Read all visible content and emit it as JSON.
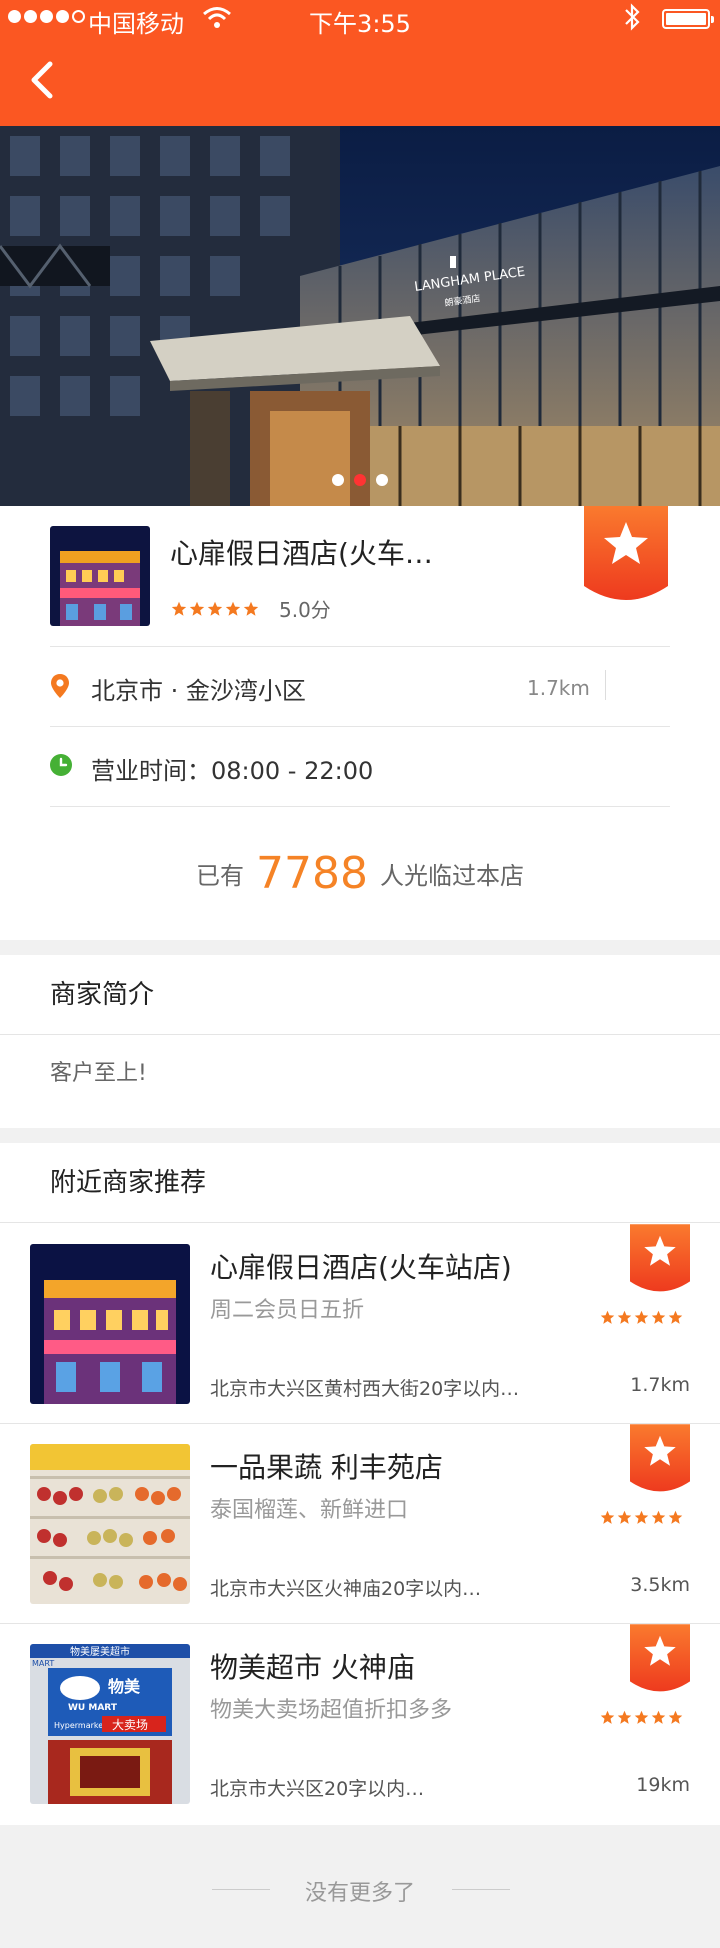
{
  "status_bar": {
    "carrier": "中国移动",
    "time": "下午3:55"
  },
  "colors": {
    "brand": "#fb5722",
    "accent_number": "#f58326",
    "star": "#f47920",
    "hours_icon": "#45b035"
  },
  "shop": {
    "name": "心扉假日酒店(火车…",
    "rating_stars": 5,
    "score": "5.0分",
    "address": "北京市 · 金沙湾小区",
    "distance": "1.7km",
    "hours": "营业时间：08:00 - 22:00",
    "visit_prefix": "已有",
    "visit_count": "7788",
    "visit_suffix": "人光临过本店"
  },
  "hero": {
    "building_sign_1": "LANGHAM PLACE",
    "building_sign_2": "朗豪酒店",
    "active_slide": 2,
    "slide_count": 3
  },
  "intro": {
    "heading": "商家简介",
    "text": "客户至上!"
  },
  "nearby": {
    "heading": "附近商家推荐",
    "items": [
      {
        "title": "心扉假日酒店(火车站店)",
        "subtitle": "周二会员日五折",
        "location": "北京市大兴区黄村西大街20字以内…",
        "distance": "1.7km"
      },
      {
        "title": "一品果蔬 利丰苑店",
        "subtitle": "泰国榴莲、新鲜进口",
        "location": "北京市大兴区火神庙20字以内…",
        "distance": "3.5km"
      },
      {
        "title": "物美超市 火神庙",
        "subtitle": "物美大卖场超值折扣多多",
        "location": "北京市大兴区20字以内…",
        "distance": "19km"
      }
    ]
  },
  "store_signs": {
    "top": "物美屡美超市",
    "brand_cn": "物美",
    "brand_en": "WU MART",
    "hypermarket": "Hypermarket",
    "big": "大卖场",
    "mart": "MART"
  },
  "footer": {
    "text": "没有更多了"
  }
}
